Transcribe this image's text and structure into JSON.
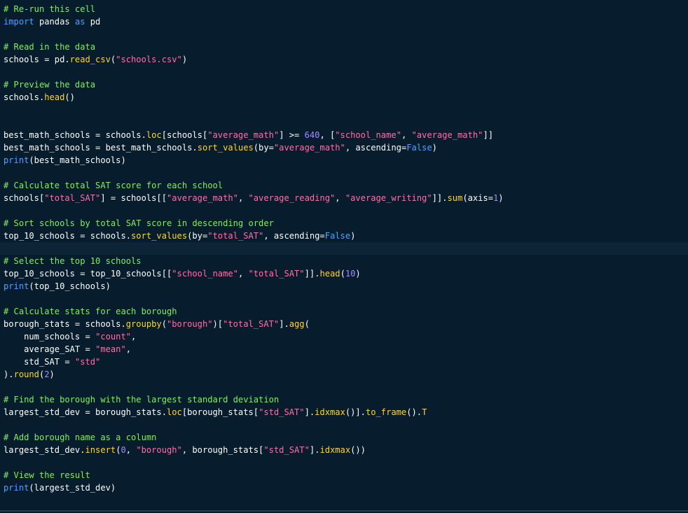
{
  "editor": {
    "colors": {
      "background": "#071c2c",
      "active_line": "#0c2435",
      "comment": "#7ef068",
      "keyword": "#4fa3ff",
      "string": "#ff70a6",
      "function": "#ffd43b",
      "number": "#a58cff",
      "text": "#ffffff"
    },
    "active_line": 19,
    "lines": [
      [
        {
          "t": "comment",
          "v": "# Re-run this cell"
        }
      ],
      [
        {
          "t": "kw",
          "v": "import"
        },
        {
          "t": "plain",
          "v": " pandas "
        },
        {
          "t": "kw",
          "v": "as"
        },
        {
          "t": "plain",
          "v": " pd"
        }
      ],
      [],
      [
        {
          "t": "comment",
          "v": "# Read in the data"
        }
      ],
      [
        {
          "t": "plain",
          "v": "schools = pd."
        },
        {
          "t": "fn",
          "v": "read_csv"
        },
        {
          "t": "plain",
          "v": "("
        },
        {
          "t": "str",
          "v": "\"schools.csv\""
        },
        {
          "t": "plain",
          "v": ")"
        }
      ],
      [],
      [
        {
          "t": "comment",
          "v": "# Preview the data"
        }
      ],
      [
        {
          "t": "plain",
          "v": "schools."
        },
        {
          "t": "fn",
          "v": "head"
        },
        {
          "t": "plain",
          "v": "()"
        }
      ],
      [],
      [],
      [
        {
          "t": "plain",
          "v": "best_math_schools = schools."
        },
        {
          "t": "fn",
          "v": "loc"
        },
        {
          "t": "plain",
          "v": "[schools["
        },
        {
          "t": "str",
          "v": "\"average_math\""
        },
        {
          "t": "plain",
          "v": "] >= "
        },
        {
          "t": "num",
          "v": "640"
        },
        {
          "t": "plain",
          "v": ", ["
        },
        {
          "t": "str",
          "v": "\"school_name\""
        },
        {
          "t": "plain",
          "v": ", "
        },
        {
          "t": "str",
          "v": "\"average_math\""
        },
        {
          "t": "plain",
          "v": "]]"
        }
      ],
      [
        {
          "t": "plain",
          "v": "best_math_schools = best_math_schools."
        },
        {
          "t": "fn",
          "v": "sort_values"
        },
        {
          "t": "plain",
          "v": "(by="
        },
        {
          "t": "str",
          "v": "\"average_math\""
        },
        {
          "t": "plain",
          "v": ", ascending="
        },
        {
          "t": "kw",
          "v": "False"
        },
        {
          "t": "plain",
          "v": ")"
        }
      ],
      [
        {
          "t": "kw",
          "v": "print"
        },
        {
          "t": "plain",
          "v": "(best_math_schools)"
        }
      ],
      [],
      [
        {
          "t": "comment",
          "v": "# Calculate total SAT score for each school"
        }
      ],
      [
        {
          "t": "plain",
          "v": "schools["
        },
        {
          "t": "str",
          "v": "\"total_SAT\""
        },
        {
          "t": "plain",
          "v": "] = schools[["
        },
        {
          "t": "str",
          "v": "\"average_math\""
        },
        {
          "t": "plain",
          "v": ", "
        },
        {
          "t": "str",
          "v": "\"average_reading\""
        },
        {
          "t": "plain",
          "v": ", "
        },
        {
          "t": "str",
          "v": "\"average_writing\""
        },
        {
          "t": "plain",
          "v": "]]."
        },
        {
          "t": "fn",
          "v": "sum"
        },
        {
          "t": "plain",
          "v": "(axis="
        },
        {
          "t": "num",
          "v": "1"
        },
        {
          "t": "plain",
          "v": ")"
        }
      ],
      [],
      [
        {
          "t": "comment",
          "v": "# Sort schools by total SAT score in descending order"
        }
      ],
      [
        {
          "t": "plain",
          "v": "top_10_schools = schools."
        },
        {
          "t": "fn",
          "v": "sort_values"
        },
        {
          "t": "plain",
          "v": "(by="
        },
        {
          "t": "str",
          "v": "\"total_SAT\""
        },
        {
          "t": "plain",
          "v": ", ascending="
        },
        {
          "t": "kw",
          "v": "False"
        },
        {
          "t": "plain",
          "v": ")"
        }
      ],
      [],
      [
        {
          "t": "comment",
          "v": "# Select the top 10 schools"
        }
      ],
      [
        {
          "t": "plain",
          "v": "top_10_schools = top_10_schools[["
        },
        {
          "t": "str",
          "v": "\"school_name\""
        },
        {
          "t": "plain",
          "v": ", "
        },
        {
          "t": "str",
          "v": "\"total_SAT\""
        },
        {
          "t": "plain",
          "v": "]]."
        },
        {
          "t": "fn",
          "v": "head"
        },
        {
          "t": "plain",
          "v": "("
        },
        {
          "t": "num",
          "v": "10"
        },
        {
          "t": "plain",
          "v": ")"
        }
      ],
      [
        {
          "t": "kw",
          "v": "print"
        },
        {
          "t": "plain",
          "v": "(top_10_schools)"
        }
      ],
      [],
      [
        {
          "t": "comment",
          "v": "# Calculate stats for each borough"
        }
      ],
      [
        {
          "t": "plain",
          "v": "borough_stats = schools."
        },
        {
          "t": "fn",
          "v": "groupby"
        },
        {
          "t": "plain",
          "v": "("
        },
        {
          "t": "str",
          "v": "\"borough\""
        },
        {
          "t": "plain",
          "v": ")["
        },
        {
          "t": "str",
          "v": "\"total_SAT\""
        },
        {
          "t": "plain",
          "v": "]."
        },
        {
          "t": "fn",
          "v": "agg"
        },
        {
          "t": "plain",
          "v": "("
        }
      ],
      [
        {
          "t": "plain",
          "v": "    num_schools = "
        },
        {
          "t": "str",
          "v": "\"count\""
        },
        {
          "t": "plain",
          "v": ","
        }
      ],
      [
        {
          "t": "plain",
          "v": "    average_SAT = "
        },
        {
          "t": "str",
          "v": "\"mean\""
        },
        {
          "t": "plain",
          "v": ","
        }
      ],
      [
        {
          "t": "plain",
          "v": "    std_SAT = "
        },
        {
          "t": "str",
          "v": "\"std\""
        }
      ],
      [
        {
          "t": "plain",
          "v": ")."
        },
        {
          "t": "fn",
          "v": "round"
        },
        {
          "t": "plain",
          "v": "("
        },
        {
          "t": "num",
          "v": "2"
        },
        {
          "t": "plain",
          "v": ")"
        }
      ],
      [],
      [
        {
          "t": "comment",
          "v": "# Find the borough with the largest standard deviation"
        }
      ],
      [
        {
          "t": "plain",
          "v": "largest_std_dev = borough_stats."
        },
        {
          "t": "fn",
          "v": "loc"
        },
        {
          "t": "plain",
          "v": "[borough_stats["
        },
        {
          "t": "str",
          "v": "\"std_SAT\""
        },
        {
          "t": "plain",
          "v": "]."
        },
        {
          "t": "fn",
          "v": "idxmax"
        },
        {
          "t": "plain",
          "v": "()]."
        },
        {
          "t": "fn",
          "v": "to_frame"
        },
        {
          "t": "plain",
          "v": "()."
        },
        {
          "t": "fn",
          "v": "T"
        }
      ],
      [],
      [
        {
          "t": "comment",
          "v": "# Add borough name as a column"
        }
      ],
      [
        {
          "t": "plain",
          "v": "largest_std_dev."
        },
        {
          "t": "fn",
          "v": "insert"
        },
        {
          "t": "plain",
          "v": "("
        },
        {
          "t": "num",
          "v": "0"
        },
        {
          "t": "plain",
          "v": ", "
        },
        {
          "t": "str",
          "v": "\"borough\""
        },
        {
          "t": "plain",
          "v": ", borough_stats["
        },
        {
          "t": "str",
          "v": "\"std_SAT\""
        },
        {
          "t": "plain",
          "v": "]."
        },
        {
          "t": "fn",
          "v": "idxmax"
        },
        {
          "t": "plain",
          "v": "())"
        }
      ],
      [],
      [
        {
          "t": "comment",
          "v": "# View the result"
        }
      ],
      [
        {
          "t": "kw",
          "v": "print"
        },
        {
          "t": "plain",
          "v": "(largest_std_dev)"
        }
      ]
    ]
  }
}
